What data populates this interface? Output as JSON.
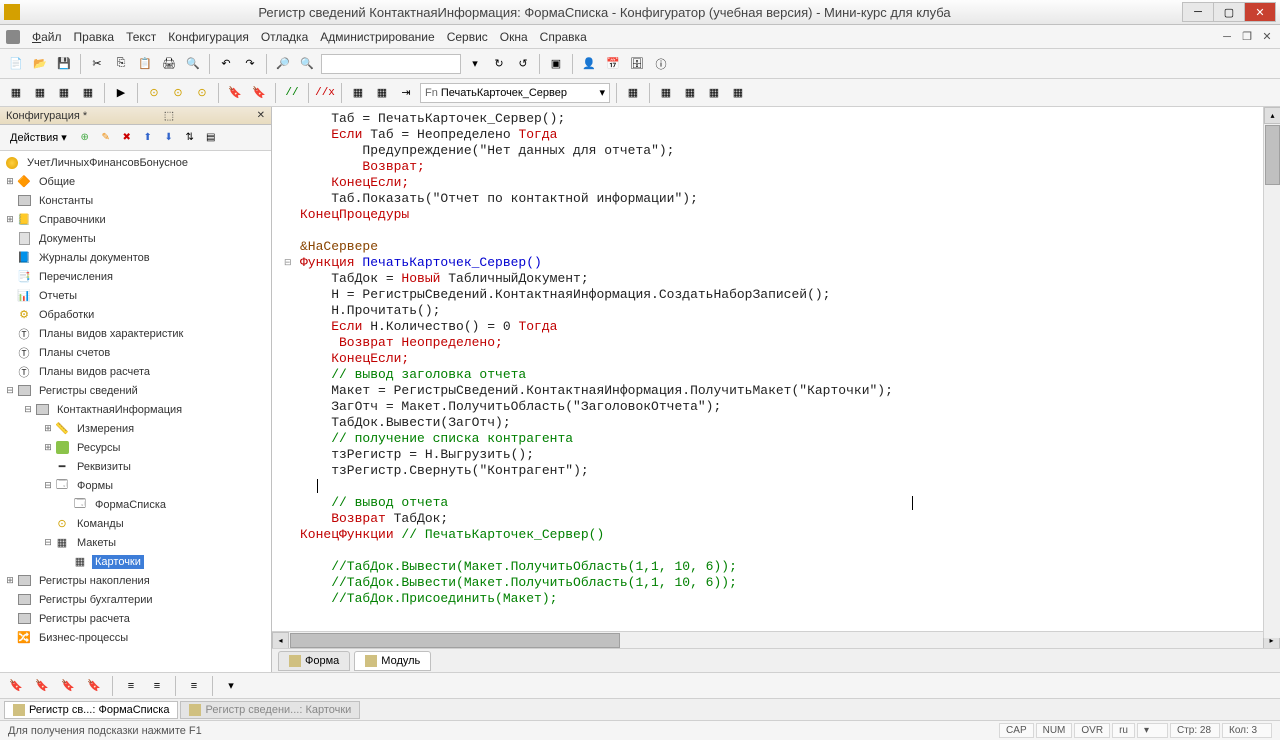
{
  "window": {
    "title": "Регистр сведений КонтактнаяИнформация: ФормаСписка - Конфигуратор (учебная версия) - Мини-курс для клуба"
  },
  "menu": {
    "file": "Файл",
    "edit": "Правка",
    "text": "Текст",
    "config": "Конфигурация",
    "debug": "Отладка",
    "admin": "Администрирование",
    "service": "Сервис",
    "windows": "Окна",
    "help": "Справка"
  },
  "toolbar2": {
    "proc_label": "ПечатьКарточек_Сервер"
  },
  "sidebar": {
    "header": "Конфигурация *",
    "actions": "Действия",
    "root": "УчетЛичныхФинансовБонусное",
    "items": [
      "Общие",
      "Константы",
      "Справочники",
      "Документы",
      "Журналы документов",
      "Перечисления",
      "Отчеты",
      "Обработки",
      "Планы видов характеристик",
      "Планы счетов",
      "Планы видов расчета",
      "Регистры сведений"
    ],
    "reg_info": "КонтактнаяИнформация",
    "reg_children": [
      "Измерения",
      "Ресурсы",
      "Реквизиты",
      "Формы"
    ],
    "forma_spiska": "ФормаСписка",
    "komandy": "Команды",
    "makety": "Макеты",
    "kartochki": "Карточки",
    "bottom_items": [
      "Регистры накопления",
      "Регистры бухгалтерии",
      "Регистры расчета",
      "Бизнес-процессы"
    ]
  },
  "code": {
    "l1": "    Таб = ПечатьКарточек_Сервер();",
    "l2a": "    Если",
    "l2b": " Таб = Неопределено ",
    "l2c": "Тогда",
    "l3a": "        Предупреждение(",
    "l3b": "\"Нет данных для отчета\"",
    "l3c": ");",
    "l4": "        Возврат;",
    "l5": "    КонецЕсли;",
    "l6a": "    Таб.Показать(",
    "l6b": "\"Отчет по контактной информации\"",
    "l6c": ");",
    "l7": "КонецПроцедуры",
    "l8": "",
    "l9": "&НаСервере",
    "l10a": "Функция",
    "l10b": " ПечатьКарточек_Сервер()",
    "l11a": "    ТабДок = ",
    "l11b": "Новый",
    "l11c": " ТабличныйДокумент;",
    "l12": "    Н = РегистрыСведений.КонтактнаяИнформация.СоздатьНаборЗаписей();",
    "l13": "    Н.Прочитать();",
    "l14a": "    Если",
    "l14b": " Н.Количество() = 0 ",
    "l14c": "Тогда",
    "l15": "     Возврат Неопределено;",
    "l16": "    КонецЕсли;",
    "l17": "    // вывод заголовка отчета",
    "l18a": "    Макет = РегистрыСведений.КонтактнаяИнформация.ПолучитьМакет(",
    "l18b": "\"Карточки\"",
    "l18c": ");",
    "l19a": "    ЗагОтч = Макет.ПолучитьОбласть(",
    "l19b": "\"ЗаголовокОтчета\"",
    "l19c": ");",
    "l20": "    ТабДок.Вывести(ЗагОтч);",
    "l21": "    // получение списка контрагента",
    "l22": "    тзРегистр = Н.Выгрузить();",
    "l23a": "    тзРегистр.Свернуть(",
    "l23b": "\"Контрагент\"",
    "l23c": ");",
    "l24": "    ",
    "l25": "    // вывод отчета",
    "l26a": "    Возврат",
    "l26b": " ТабДок;",
    "l27a": "КонецФункции",
    "l27b": " // ПечатьКарточек_Сервер()",
    "l28": "",
    "l29": "    //ТабДок.Вывести(Макет.ПолучитьОбласть(1,1, 10, 6));",
    "l30": "    //ТабДок.Вывести(Макет.ПолучитьОбласть(1,1, 10, 6));",
    "l31": "    //ТабДок.Присоединить(Макет);"
  },
  "editor_tabs": {
    "forma": "Форма",
    "module": "Модуль"
  },
  "doctabs": {
    "t1": "Регистр св...: ФормаСписка",
    "t2": "Регистр сведени...: Карточки"
  },
  "status": {
    "hint": "Для получения подсказки нажмите F1",
    "cap": "CAP",
    "num": "NUM",
    "ovr": "OVR",
    "lang": "ru",
    "row": "Стр: 28",
    "col": "Кол: 3"
  }
}
